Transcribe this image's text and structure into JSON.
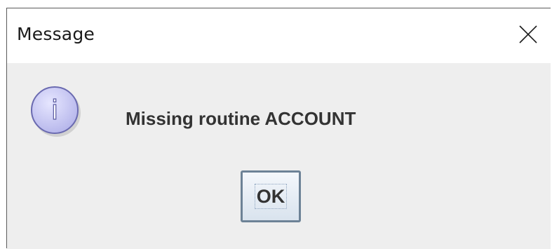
{
  "dialog": {
    "title": "Message",
    "close_icon": "close-icon",
    "message": "Missing routine ACCOUNT",
    "info_icon": "information-icon",
    "info_glyph": "i",
    "ok_label": "OK"
  },
  "colors": {
    "titlebar_bg": "#ffffff",
    "dialog_bg": "#eeeeee",
    "icon_fill": "#c8c8f4",
    "icon_stroke": "#6a6ab0",
    "button_border": "#6d8296"
  }
}
